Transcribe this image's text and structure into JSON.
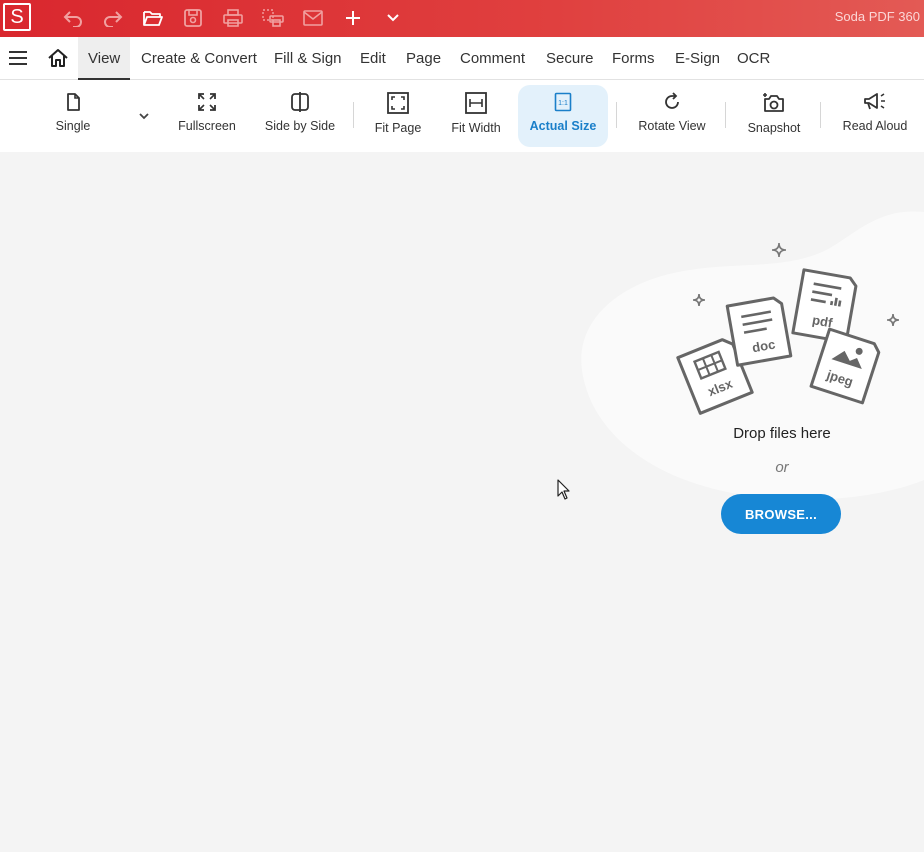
{
  "app": {
    "title": "Soda PDF 360",
    "logo_letter": "S",
    "brand_color": "#d9272e"
  },
  "quick_toolbar": {
    "icons": [
      "undo-icon",
      "redo-icon",
      "open-folder-icon",
      "save-icon",
      "print-icon",
      "print-preview-icon",
      "email-icon",
      "add-icon",
      "more-chevron-icon"
    ]
  },
  "menu": {
    "items": [
      {
        "label": "View",
        "active": true
      },
      {
        "label": "Create & Convert"
      },
      {
        "label": "Fill & Sign"
      },
      {
        "label": "Edit"
      },
      {
        "label": "Page"
      },
      {
        "label": "Comment"
      },
      {
        "label": "Secure"
      },
      {
        "label": "Forms"
      },
      {
        "label": "E-Sign"
      },
      {
        "label": "OCR"
      }
    ]
  },
  "ribbon": {
    "single": "Single",
    "fullscreen": "Fullscreen",
    "side_by_side": "Side by Side",
    "fit_page": "Fit Page",
    "fit_width": "Fit Width",
    "actual_size": "Actual Size",
    "rotate_view": "Rotate View",
    "snapshot": "Snapshot",
    "read_aloud": "Read Aloud",
    "active_color": "#1a7fc9"
  },
  "dropzone": {
    "file_types": [
      "xlsx",
      "doc",
      "pdf",
      "jpeg"
    ],
    "drop_text": "Drop files here",
    "or_text": "or",
    "browse_label": "BROWSE...",
    "browse_color": "#1787d5"
  }
}
